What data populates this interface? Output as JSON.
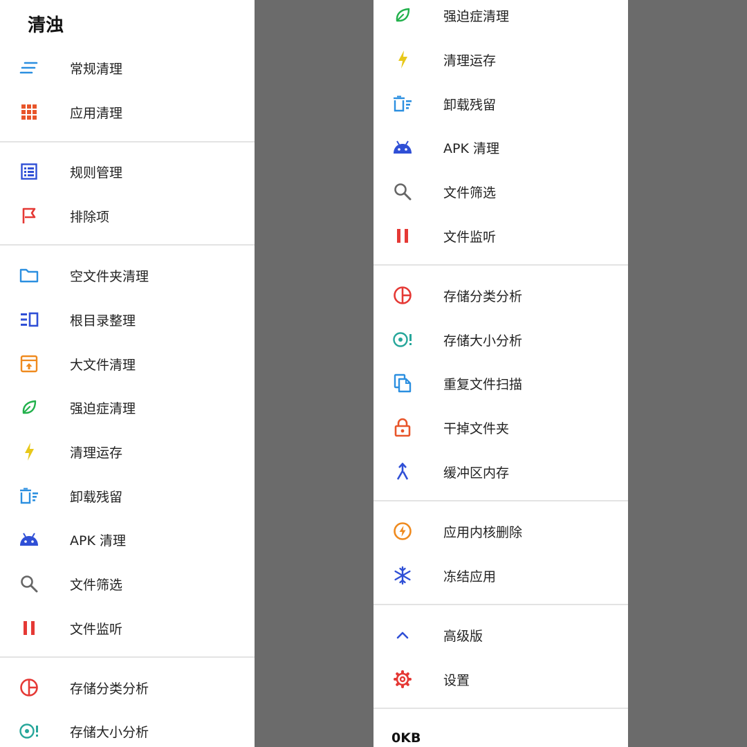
{
  "app_title": "清浊",
  "left_menu": {
    "standard_clean": "常规清理",
    "app_clean": "应用清理",
    "rule_management": "规则管理",
    "exclusions": "排除项",
    "empty_folder_clean": "空文件夹清理",
    "root_dir_organize": "根目录整理",
    "large_file_clean": "大文件清理",
    "ocd_clean": "强迫症清理",
    "memory_clean": "清理运存",
    "uninstall_residue": "卸载残留",
    "apk_clean": "APK 清理",
    "file_filter": "文件筛选",
    "file_monitor": "文件监听",
    "storage_category_analysis": "存储分类分析",
    "storage_size_analysis": "存储大小分析"
  },
  "right_menu": {
    "ocd_clean": "强迫症清理",
    "memory_clean": "清理运存",
    "uninstall_residue": "卸载残留",
    "apk_clean": "APK 清理",
    "file_filter": "文件筛选",
    "file_monitor": "文件监听",
    "storage_category_analysis": "存储分类分析",
    "storage_size_analysis": "存储大小分析",
    "duplicate_file_scan": "重复文件扫描",
    "kill_folder": "干掉文件夹",
    "buffer_memory": "缓冲区内存",
    "app_core_delete": "应用内核删除",
    "freeze_app": "冻结应用",
    "premium": "高级版",
    "settings": "设置"
  },
  "footer": {
    "storage_size": "0KB"
  },
  "icons": {
    "lines": "lines-icon",
    "grid": "grid-icon",
    "list": "list-icon",
    "flag": "flag-icon",
    "folder": "folder-icon",
    "root": "root-dir-icon",
    "archive": "archive-icon",
    "leaf": "leaf-icon",
    "bolt": "bolt-icon",
    "trash": "trash-icon",
    "android": "android-icon",
    "search": "search-icon",
    "pause": "pause-icon",
    "pie": "pie-chart-icon",
    "target": "target-icon",
    "copy": "copy-icon",
    "lock": "lock-icon",
    "merge": "merge-icon",
    "power": "power-icon",
    "snowflake": "snowflake-icon",
    "chevron_up": "chevron-up-icon",
    "gear": "gear-icon"
  },
  "colors": {
    "blue_light": "#2b8fe0",
    "blue_dark": "#2f4fd6",
    "orange_red": "#e8552a",
    "red": "#e53935",
    "orange": "#ef8a1e",
    "green": "#22b14c",
    "yellow": "#e8c81a",
    "teal": "#26a69a",
    "grey": "#666666",
    "background": "#6b6b6b"
  }
}
